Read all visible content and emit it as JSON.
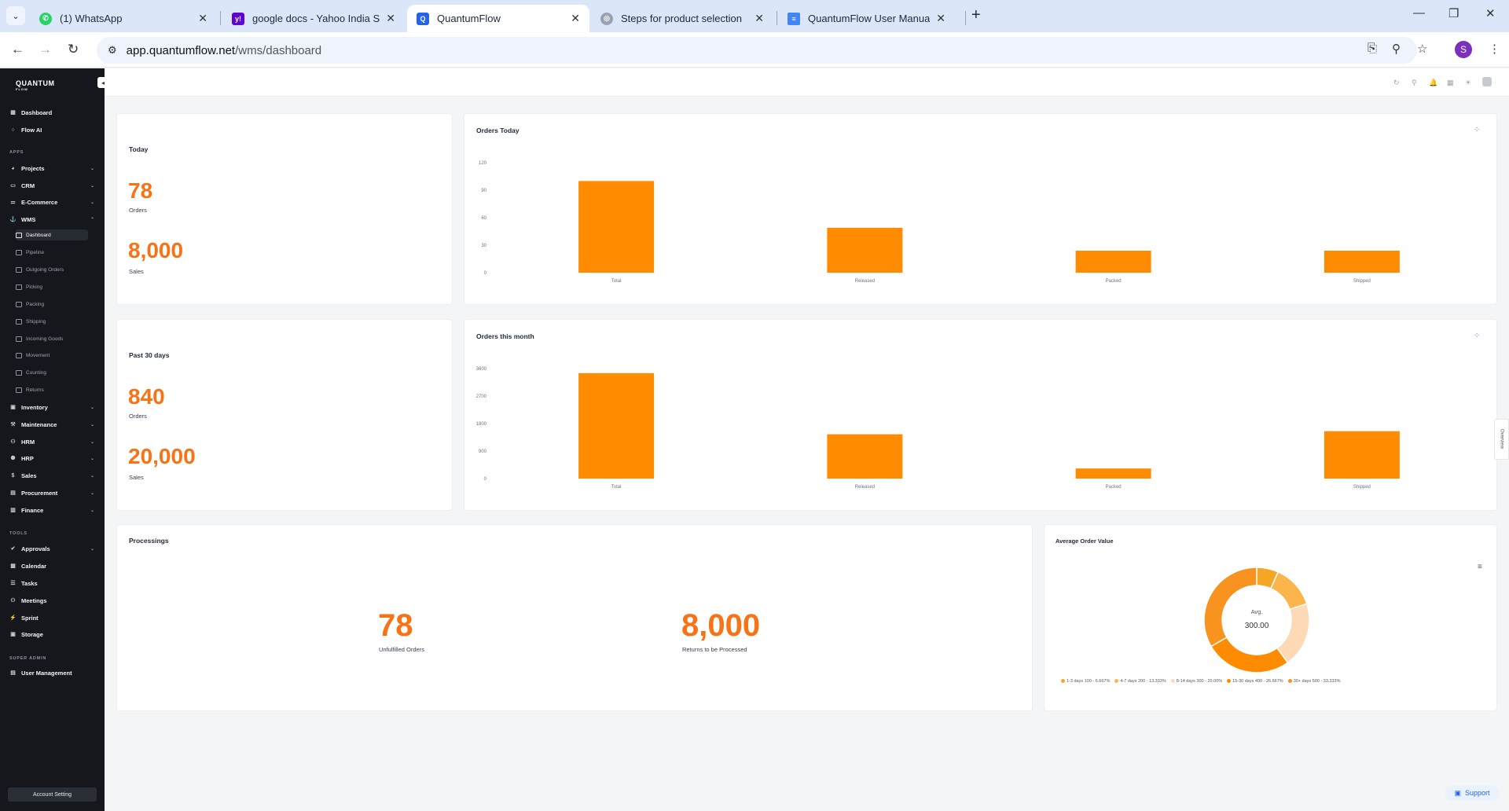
{
  "browser": {
    "tabs": [
      {
        "title": "(1) WhatsApp",
        "icon": "whatsapp-icon"
      },
      {
        "title": "google docs - Yahoo India Search",
        "icon": "yahoo-icon"
      },
      {
        "title": "QuantumFlow",
        "icon": "quantumflow-icon",
        "active": true
      },
      {
        "title": "Steps for product selection",
        "icon": "chatgpt-icon"
      },
      {
        "title": "QuantumFlow User Manual - Google Docs",
        "icon": "docs-icon"
      }
    ],
    "url_host": "app.quantumflow.net",
    "url_path": "/wms/dashboard",
    "profile_initial": "S"
  },
  "sidebar": {
    "logo": "QUANTUM",
    "logo_sub": "FLOW",
    "top_items": [
      {
        "label": "Dashboard",
        "icon": "grid-icon"
      },
      {
        "label": "Flow AI",
        "icon": "ai-icon"
      }
    ],
    "apps_label": "APPS",
    "apps": [
      {
        "label": "Projects",
        "icon": "projects-icon"
      },
      {
        "label": "CRM",
        "icon": "crm-icon"
      },
      {
        "label": "E-Commerce",
        "icon": "ecommerce-icon"
      },
      {
        "label": "WMS",
        "icon": "wms-icon",
        "expanded": true
      }
    ],
    "wms_sub": [
      {
        "label": "Dashboard",
        "active": true
      },
      {
        "label": "Pipeline"
      },
      {
        "label": "Outgoing Orders"
      },
      {
        "label": "Picking"
      },
      {
        "label": "Packing"
      },
      {
        "label": "Shipping"
      },
      {
        "label": "Incoming Goods"
      },
      {
        "label": "Movement"
      },
      {
        "label": "Counting"
      },
      {
        "label": "Returns"
      }
    ],
    "apps_more": [
      {
        "label": "Inventory",
        "icon": "inventory-icon"
      },
      {
        "label": "Maintenance",
        "icon": "maintenance-icon"
      },
      {
        "label": "HRM",
        "icon": "hrm-icon"
      },
      {
        "label": "HRP",
        "icon": "hrp-icon"
      },
      {
        "label": "Sales",
        "icon": "sales-icon"
      },
      {
        "label": "Procurement",
        "icon": "procurement-icon"
      },
      {
        "label": "Finance",
        "icon": "finance-icon"
      }
    ],
    "tools_label": "TOOLS",
    "tools": [
      {
        "label": "Approvals",
        "icon": "approvals-icon"
      },
      {
        "label": "Calendar",
        "icon": "calendar-icon"
      },
      {
        "label": "Tasks",
        "icon": "tasks-icon"
      },
      {
        "label": "Meetings",
        "icon": "meetings-icon"
      },
      {
        "label": "Sprint",
        "icon": "sprint-icon"
      },
      {
        "label": "Storage",
        "icon": "storage-icon"
      }
    ],
    "super_admin_label": "SUPER ADMIN",
    "admin": [
      {
        "label": "User Management",
        "icon": "users-icon"
      }
    ],
    "account_setting": "Account Setting"
  },
  "today": {
    "title": "Today",
    "orders_value": "78",
    "orders_label": "Orders",
    "sales_value": "8,000",
    "sales_label": "Sales"
  },
  "past30": {
    "title": "Past 30 days",
    "orders_value": "840",
    "orders_label": "Orders",
    "sales_value": "20,000",
    "sales_label": "Sales"
  },
  "processings": {
    "title": "Processings",
    "unfulfilled_value": "78",
    "unfulfilled_label": "Unfulfilled Orders",
    "returns_value": "8,000",
    "returns_label": "Returns to be Processed"
  },
  "aov": {
    "title": "Average Order Value",
    "center_label": "Avg.",
    "center_value": "300.00"
  },
  "overview_label": "Overview",
  "support_label": "Support",
  "colors": {
    "accent": "#f97316",
    "bar": "#ff8c00",
    "sidebar_bg": "#15171c"
  },
  "chart_data": [
    {
      "type": "bar",
      "title": "Orders Today",
      "categories": [
        "Total",
        "Released",
        "Packed",
        "Shipped"
      ],
      "values": [
        100,
        49,
        24,
        24
      ],
      "ylim": [
        0,
        120
      ],
      "yticks": [
        0,
        30,
        60,
        90,
        120
      ]
    },
    {
      "type": "bar",
      "title": "Orders this month",
      "categories": [
        "Total",
        "Released",
        "Packed",
        "Shipped"
      ],
      "values": [
        3450,
        1450,
        330,
        1550
      ],
      "ylim": [
        0,
        3600
      ],
      "yticks": [
        0,
        900,
        1800,
        2700,
        3600
      ]
    },
    {
      "type": "pie",
      "title": "Average Order Value",
      "labels": [
        "1-3 days 100 - 6.667%",
        "4-7 days 200 - 13.333%",
        "8-14 days 300 - 20.00%",
        "15-30 days 400 - 26.667%",
        "30+ days 500 - 33.333%"
      ],
      "values": [
        6.667,
        13.333,
        20.0,
        26.667,
        33.333
      ],
      "colors": [
        "#f5a623",
        "#fbb54a",
        "#fdd9b5",
        "#ff8c00",
        "#f7931e"
      ]
    }
  ]
}
